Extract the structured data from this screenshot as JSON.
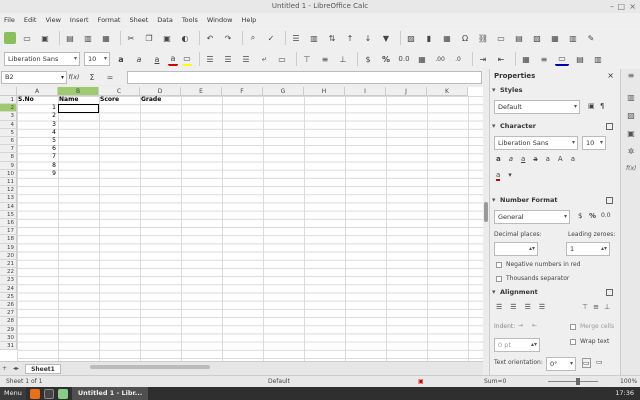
{
  "window": {
    "title": "Untitled 1 - LibreOffice Calc"
  },
  "menu": [
    "File",
    "Edit",
    "View",
    "Insert",
    "Format",
    "Sheet",
    "Data",
    "Tools",
    "Window",
    "Help"
  ],
  "toolbar2": {
    "font_name": "Liberation Sans",
    "font_size": "10"
  },
  "formula_bar": {
    "name_box": "B2",
    "fx_label": "f(x)",
    "sum_label": "Σ",
    "eq_label": "="
  },
  "grid": {
    "columns": [
      "A",
      "B",
      "C",
      "D",
      "E",
      "F",
      "G",
      "H",
      "I",
      "J",
      "K"
    ],
    "rows": [
      "1",
      "2",
      "3",
      "4",
      "5",
      "6",
      "7",
      "8",
      "9",
      "10",
      "11",
      "12",
      "13",
      "14",
      "15",
      "16",
      "17",
      "18",
      "19",
      "20",
      "21",
      "22",
      "23",
      "24",
      "25",
      "26",
      "27",
      "28",
      "29",
      "30",
      "31"
    ],
    "header_row": [
      "S.No",
      "Name",
      "Score",
      "Grade"
    ],
    "sno_values": [
      "1",
      "2",
      "3",
      "4",
      "5",
      "6",
      "7",
      "8",
      "9"
    ]
  },
  "sheet_tabs": {
    "active": "Sheet1",
    "add_label": "+"
  },
  "status": {
    "sheet": "Sheet 1 of 1",
    "style": "Default",
    "sum": "Sum=0",
    "zoom": "100%"
  },
  "taskbar": {
    "menu": "Menu",
    "window": "Untitled 1 - Libr...",
    "time": "17:36"
  },
  "sidebar": {
    "title": "Properties",
    "styles": {
      "header": "Styles",
      "value": "Default"
    },
    "character": {
      "header": "Character",
      "font": "Liberation Sans",
      "size": "10"
    },
    "number_format": {
      "header": "Number Format",
      "category": "General",
      "decimal_label": "Decimal places:",
      "leading_label": "Leading zeroes:",
      "leading_value": "1",
      "negative_label": "Negative numbers in red",
      "thousands_label": "Thousands separator",
      "buttons": [
        "$",
        "%",
        "0.0"
      ]
    },
    "alignment": {
      "header": "Alignment",
      "indent_label": "Indent:",
      "indent_value": "0 pt",
      "merge_label": "Merge cells",
      "wrap_label": "Wrap text",
      "orientation_label": "Text orientation:",
      "orientation_value": "0°"
    }
  }
}
